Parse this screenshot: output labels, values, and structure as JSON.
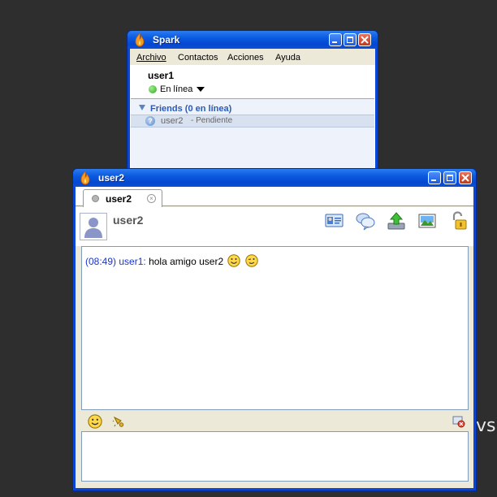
{
  "desktop": {
    "partial_text": "vs S"
  },
  "spark_window": {
    "title": "Spark",
    "menu": [
      "Archivo",
      "Contactos",
      "Acciones",
      "Ayuda"
    ],
    "user": {
      "name": "user1",
      "status": "En línea"
    },
    "group": {
      "label": "Friends (0 en línea)"
    },
    "contacts": [
      {
        "name": "user2",
        "status": "- Pendiente"
      }
    ]
  },
  "chat_window": {
    "title": "user2",
    "tab_label": "user2",
    "header_name": "user2",
    "toolbar_icons": [
      "vcard-icon",
      "chat-history-icon",
      "send-file-icon",
      "screenshot-icon",
      "unlock-icon"
    ],
    "messages": [
      {
        "time": "(08:49)",
        "sender": "user1:",
        "text": "hola amigo user2",
        "emoticons": [
          "smile-icon",
          "wink-icon"
        ]
      }
    ],
    "bottom_toolbar_icons": [
      "emoticon-icon",
      "nudge-icon",
      "close-chat-icon"
    ],
    "input_value": ""
  }
}
